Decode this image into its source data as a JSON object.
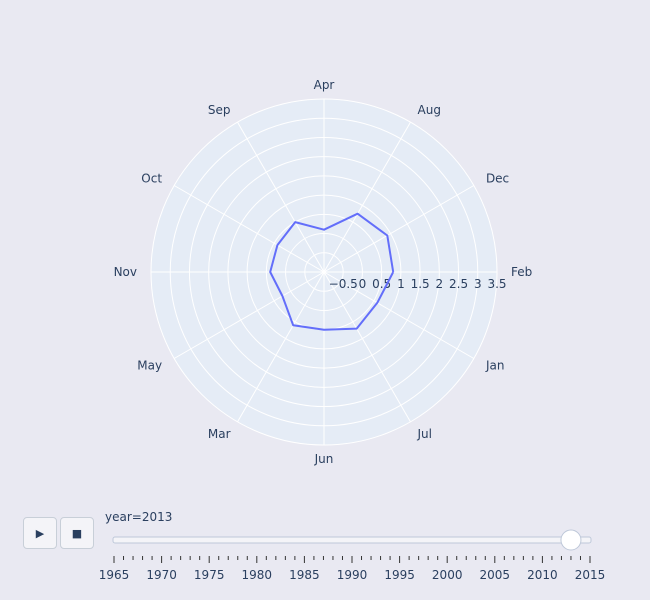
{
  "chart_data": {
    "type": "polar-line",
    "angular_categories": [
      "Feb",
      "Dec",
      "Aug",
      "Apr",
      "Sep",
      "Oct",
      "Nov",
      "May",
      "Mar",
      "Jun",
      "Jul",
      "Jan"
    ],
    "radial_tick_labels": [
      "−0.5",
      "0",
      "0.5",
      "1",
      "1.5",
      "2",
      "2.5",
      "3",
      "3.5"
    ],
    "radial_range": [
      -1,
      3.5
    ],
    "series": [
      {
        "color": "#636efa",
        "values": [
          0.8,
          0.9,
          0.75,
          0.1,
          0.5,
          0.4,
          0.4,
          0.25,
          0.6,
          0.5,
          0.7,
          0.6
        ]
      }
    ],
    "grid": true
  },
  "controls": {
    "play_icon": "▶",
    "stop_icon": "■",
    "slider_label": "year=2013",
    "slider_value": 2013,
    "slider_range": [
      1965,
      2015
    ],
    "slider_tick_labels": [
      "1965",
      "1970",
      "1975",
      "1980",
      "1985",
      "1990",
      "1995",
      "2000",
      "2005",
      "2010",
      "2015"
    ]
  }
}
